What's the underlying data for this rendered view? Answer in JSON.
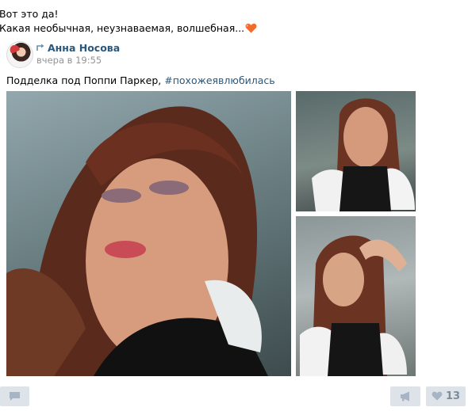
{
  "post": {
    "line1": "Вот это да!",
    "line2": "Какая необычная, неузнаваемая, волшебная...",
    "heart_icon": "heart-emoji"
  },
  "repost": {
    "author": "Анна Носова",
    "date": "вчера в 19:55",
    "icon": "repost-arrow-icon"
  },
  "caption": {
    "text": "Подделка под Поппи Паркер, ",
    "hashtag": "#похожеявлюбилась"
  },
  "photos": [
    {
      "alt": "doll-closeup-photo"
    },
    {
      "alt": "doll-upper-body-photo"
    },
    {
      "alt": "doll-hand-on-head-photo"
    }
  ],
  "actions": {
    "comment_icon": "comment-icon",
    "share_icon": "megaphone-icon",
    "like_icon": "heart-icon",
    "like_count": "13"
  },
  "colors": {
    "link": "#2b587a",
    "meta": "#939393",
    "button_bg": "#dee3e9",
    "heart": "#f26b2a"
  }
}
